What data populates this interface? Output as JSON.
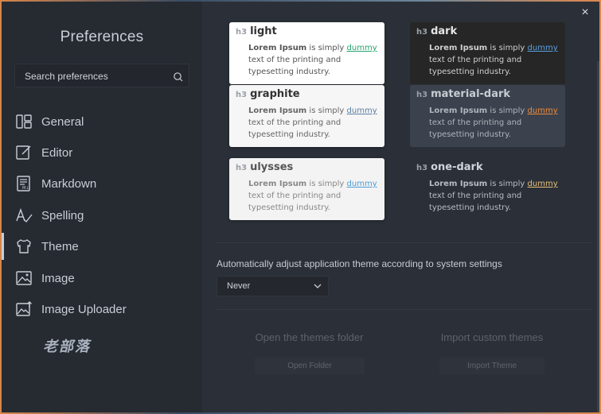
{
  "sidebar": {
    "title": "Preferences",
    "search_placeholder": "Search preferences",
    "items": [
      {
        "label": "General"
      },
      {
        "label": "Editor"
      },
      {
        "label": "Markdown"
      },
      {
        "label": "Spelling"
      },
      {
        "label": "Theme"
      },
      {
        "label": "Image"
      },
      {
        "label": "Image Uploader"
      }
    ],
    "watermark": "老部落"
  },
  "themes": [
    {
      "name": "light",
      "tag": "h3",
      "desc_bold": "Lorem Ipsum",
      "desc_pre": " is simply ",
      "desc_link": "dummy",
      "desc_post": " text of the printing and typesetting industry."
    },
    {
      "name": "dark",
      "tag": "h3",
      "desc_bold": "Lorem Ipsum",
      "desc_pre": " is simply ",
      "desc_link": "dummy",
      "desc_post": " text of the printing and typesetting industry."
    },
    {
      "name": "graphite",
      "tag": "h3",
      "desc_bold": "Lorem Ipsum",
      "desc_pre": " is simply ",
      "desc_link": "dummy",
      "desc_post": " text of the printing and typesetting industry."
    },
    {
      "name": "material-dark",
      "tag": "h3",
      "desc_bold": "Lorem Ipsum",
      "desc_pre": " is simply ",
      "desc_link": "dummy",
      "desc_post": " text of the printing and typesetting industry."
    },
    {
      "name": "ulysses",
      "tag": "h3",
      "desc_bold": "Lorem Ipsum",
      "desc_pre": " is simply ",
      "desc_link": "dummy",
      "desc_post": " text of the printing and typesetting industry."
    },
    {
      "name": "one-dark",
      "tag": "h3",
      "desc_bold": "Lorem Ipsum",
      "desc_pre": " is simply ",
      "desc_link": "dummy",
      "desc_post": " text of the printing and typesetting industry."
    }
  ],
  "auto_theme": {
    "label": "Automatically adjust application theme according to system settings",
    "selected": "Never"
  },
  "folders": {
    "open_title": "Open the themes folder",
    "open_button": "Open Folder",
    "import_title": "Import custom themes",
    "import_button": "Import Theme"
  },
  "close_icon": "×"
}
